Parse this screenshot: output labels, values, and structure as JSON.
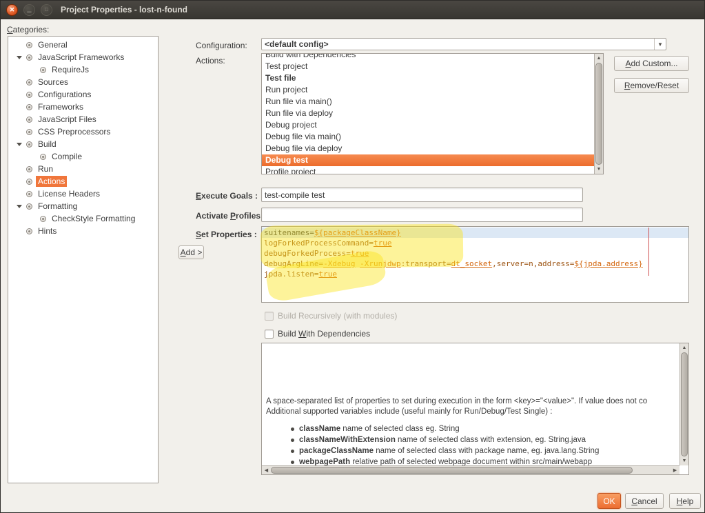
{
  "window": {
    "title": "Project Properties - lost-n-found"
  },
  "categories": {
    "label": "Categories:",
    "items": [
      {
        "label": "General",
        "indent": 0
      },
      {
        "label": "JavaScript Frameworks",
        "indent": 0,
        "expanded": true
      },
      {
        "label": "RequireJs",
        "indent": 1
      },
      {
        "label": "Sources",
        "indent": 0
      },
      {
        "label": "Configurations",
        "indent": 0
      },
      {
        "label": "Frameworks",
        "indent": 0
      },
      {
        "label": "JavaScript Files",
        "indent": 0
      },
      {
        "label": "CSS Preprocessors",
        "indent": 0
      },
      {
        "label": "Build",
        "indent": 0,
        "expanded": true
      },
      {
        "label": "Compile",
        "indent": 1
      },
      {
        "label": "Run",
        "indent": 0
      },
      {
        "label": "Actions",
        "indent": 0,
        "selected": true
      },
      {
        "label": "License Headers",
        "indent": 0
      },
      {
        "label": "Formatting",
        "indent": 0,
        "expanded": true
      },
      {
        "label": "CheckStyle Formatting",
        "indent": 1
      },
      {
        "label": "Hints",
        "indent": 0
      }
    ]
  },
  "configuration": {
    "label": "Configuration:",
    "value": "<default config>"
  },
  "actions": {
    "label": "Actions:",
    "add_custom_label": "Add Custom...",
    "remove_reset_label": "Remove/Reset",
    "items": [
      {
        "label": "Build with Dependencies"
      },
      {
        "label": "Test project"
      },
      {
        "label": "Test file",
        "bold": true
      },
      {
        "label": "Run project"
      },
      {
        "label": "Run file via main()"
      },
      {
        "label": "Run file via deploy"
      },
      {
        "label": "Debug project"
      },
      {
        "label": "Debug file via main()"
      },
      {
        "label": "Debug file via deploy"
      },
      {
        "label": "Debug test",
        "bold": true,
        "selected": true
      },
      {
        "label": "Profile project"
      }
    ]
  },
  "execute_goals": {
    "label": "Execute Goals :",
    "value": "test-compile test"
  },
  "activate_profiles": {
    "label": "Activate Profiles :",
    "value": ""
  },
  "set_properties": {
    "label": "Set Properties :",
    "add_label": "Add >",
    "lines": [
      {
        "selected": true,
        "segments": [
          {
            "t": "suitenames=",
            "c": "p"
          },
          {
            "t": "${packageClassName}",
            "c": "v"
          }
        ]
      },
      {
        "segments": [
          {
            "t": "logForkedProcessCommand=",
            "c": "k"
          },
          {
            "t": "true",
            "c": "v"
          }
        ]
      },
      {
        "segments": [
          {
            "t": "debugForkedProcess=",
            "c": "k"
          },
          {
            "t": "true",
            "c": "v"
          }
        ]
      },
      {
        "segments": [
          {
            "t": "debugArgLine=",
            "c": "k"
          },
          {
            "t": "-Xdebug",
            "c": "v"
          },
          {
            "t": " ",
            "c": "p"
          },
          {
            "t": "-Xrunjdwp",
            "c": "v"
          },
          {
            "t": ":transport=",
            "c": "k"
          },
          {
            "t": "dt_socket",
            "c": "v"
          },
          {
            "t": ",server=n,address=",
            "c": "k"
          },
          {
            "t": "${jpda.address}",
            "c": "v"
          }
        ]
      },
      {
        "segments": [
          {
            "t": "jpda.listen=",
            "c": "k"
          },
          {
            "t": "true",
            "c": "v"
          }
        ]
      }
    ]
  },
  "checkboxes": {
    "recursive": "Build Recursively (with modules)",
    "with_deps": "Build With Dependencies"
  },
  "help": {
    "para1": "A space-separated list of properties to set during execution in the form <key>=\"<value>\". If value does not co",
    "para2": "Additional supported variables include (useful mainly for Run/Debug/Test Single) :",
    "bullets": [
      {
        "term": "className",
        "rest": " name of selected class eg. String"
      },
      {
        "term": "classNameWithExtension",
        "rest": " name of selected class with extension, eg. String.java"
      },
      {
        "term": "packageClassName",
        "rest": " name of selected class with package name, eg. java.lang.String"
      },
      {
        "term": "webpagePath",
        "rest": " relative path of selected webpage document within src/main/webapp"
      }
    ]
  },
  "footer": {
    "ok": "OK",
    "cancel": "Cancel",
    "help": "Help"
  },
  "colors": {
    "accent": "#f0763b",
    "selection_gradient_top": "#f68b50",
    "selection_gradient_bottom": "#ec6c2c",
    "highlighter": "#fae41e",
    "margin_guide": "#cf4f4f",
    "titlebar": "#3e3c38"
  }
}
